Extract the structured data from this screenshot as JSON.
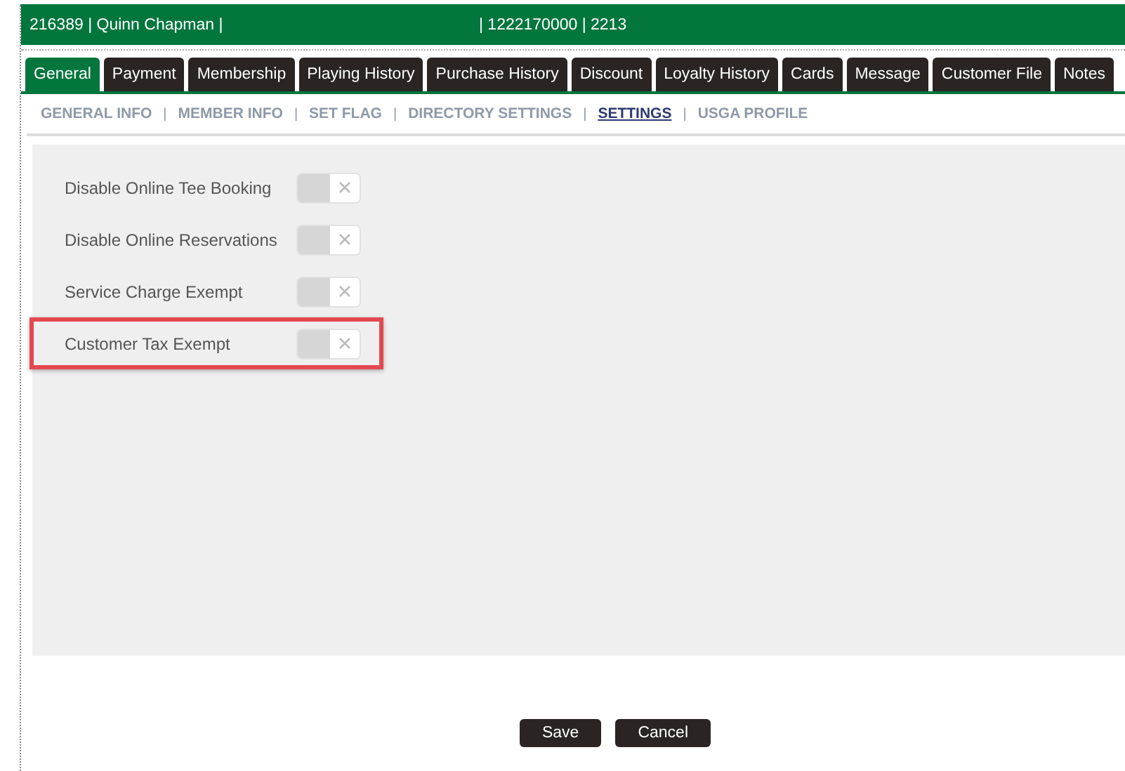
{
  "header": {
    "left": "216389 | Quinn Chapman |",
    "right": "| 1222170000 | 2213"
  },
  "tabs": [
    {
      "label": "General",
      "selected": true
    },
    {
      "label": "Payment",
      "selected": false
    },
    {
      "label": "Membership",
      "selected": false
    },
    {
      "label": "Playing History",
      "selected": false
    },
    {
      "label": "Purchase History",
      "selected": false
    },
    {
      "label": "Discount",
      "selected": false
    },
    {
      "label": "Loyalty History",
      "selected": false
    },
    {
      "label": "Cards",
      "selected": false
    },
    {
      "label": "Message",
      "selected": false
    },
    {
      "label": "Customer File",
      "selected": false
    },
    {
      "label": "Notes",
      "selected": false
    }
  ],
  "subnav": [
    {
      "label": "GENERAL INFO",
      "selected": false
    },
    {
      "separator": "|",
      "label": "MEMBER INFO",
      "selected": false
    },
    {
      "separator": "|",
      "label": "SET FLAG",
      "selected": false
    },
    {
      "separator": "|",
      "label": "DIRECTORY SETTINGS",
      "selected": false
    },
    {
      "separator": "|",
      "label": "SETTINGS",
      "selected": true
    },
    {
      "separator": "|",
      "label": "USGA PROFILE",
      "selected": false
    }
  ],
  "settings": [
    {
      "label": "Disable Online Tee Booking",
      "on": false,
      "highlighted": false
    },
    {
      "label": "Disable Online Reservations",
      "on": false,
      "highlighted": false
    },
    {
      "label": "Service Charge Exempt",
      "on": false,
      "highlighted": false
    },
    {
      "label": "Customer Tax Exempt",
      "on": false,
      "highlighted": true
    }
  ],
  "buttons": [
    {
      "label": "Save"
    },
    {
      "label": "Cancel"
    }
  ]
}
